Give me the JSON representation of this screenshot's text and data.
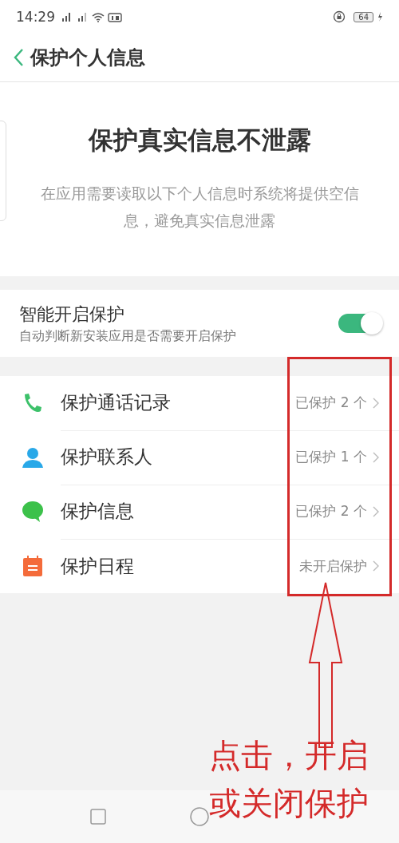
{
  "status_bar": {
    "time": "14:29",
    "battery": "64"
  },
  "header": {
    "title": "保护个人信息"
  },
  "intro": {
    "heading": "保护真实信息不泄露",
    "description": "在应用需要读取以下个人信息时系统将提供空信息，避免真实信息泄露"
  },
  "smart_protection": {
    "title": "智能开启保护",
    "subtitle": "自动判断新安装应用是否需要开启保护",
    "on": true
  },
  "items": [
    {
      "kind": "phone",
      "label": "保护通话记录",
      "status": "已保护 2 个"
    },
    {
      "kind": "contact",
      "label": "保护联系人",
      "status": "已保护 1 个"
    },
    {
      "kind": "message",
      "label": "保护信息",
      "status": "已保护 2 个"
    },
    {
      "kind": "calendar",
      "label": "保护日程",
      "status": "未开启保护"
    }
  ],
  "annotation": {
    "lines": [
      "点击，开启",
      "或关闭保护"
    ]
  }
}
